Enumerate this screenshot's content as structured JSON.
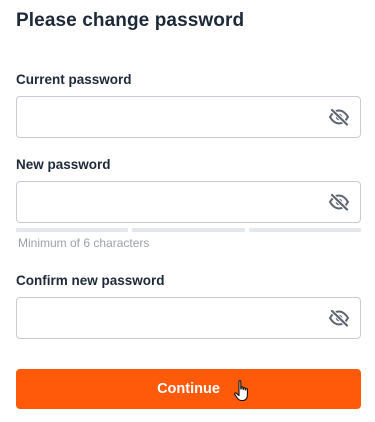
{
  "page": {
    "title": "Please change password"
  },
  "fields": {
    "current": {
      "label": "Current password",
      "value": "",
      "placeholder": "",
      "toggle_icon": "eye-slash-icon"
    },
    "new": {
      "label": "New password",
      "value": "",
      "placeholder": "",
      "toggle_icon": "eye-slash-icon",
      "hint": "Minimum of 6 characters",
      "strength_segments": 3,
      "strength_filled": 0
    },
    "confirm": {
      "label": "Confirm new password",
      "value": "",
      "placeholder": "",
      "toggle_icon": "eye-slash-icon"
    }
  },
  "actions": {
    "continue_label": "Continue",
    "continue_color": "#ff5a0a"
  },
  "cursor": {
    "icon": "hand-pointer-icon"
  }
}
